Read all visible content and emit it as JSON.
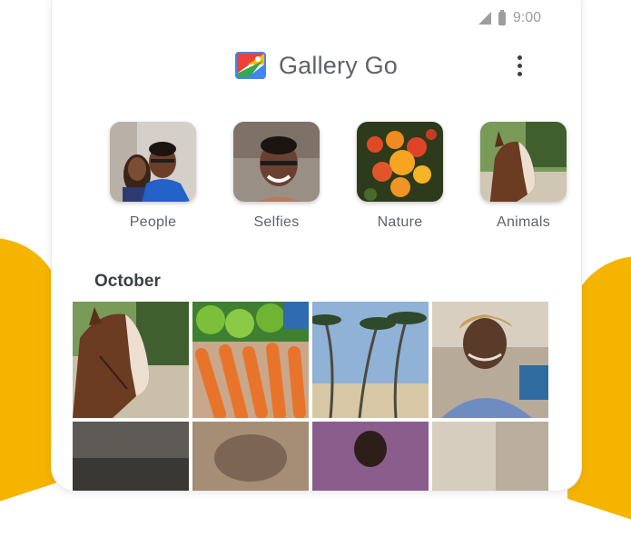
{
  "status_bar": {
    "time": "9:00",
    "icons": [
      "signal-icon",
      "battery-icon"
    ]
  },
  "header": {
    "title": "Gallery Go",
    "logo_icon": "gallery-go-logo",
    "menu_icon": "more-vert-icon",
    "logo_colors": [
      "#ea4335",
      "#fbbc04",
      "#34a853",
      "#4285f4"
    ]
  },
  "categories": [
    {
      "label": "People",
      "thumbnail": "two-people-photo"
    },
    {
      "label": "Selfies",
      "thumbnail": "selfie-photo"
    },
    {
      "label": "Nature",
      "thumbnail": "flowers-photo"
    },
    {
      "label": "Animals",
      "thumbnail": "horse-photo"
    }
  ],
  "section": {
    "title": "October"
  },
  "grid": [
    {
      "thumbnail": "horse-photo"
    },
    {
      "thumbnail": "vegetables-photo"
    },
    {
      "thumbnail": "palm-trees-photo"
    },
    {
      "thumbnail": "portrait-photo"
    },
    {
      "thumbnail": "dark-photo"
    },
    {
      "thumbnail": "blurred-photo"
    },
    {
      "thumbnail": "people-photo"
    },
    {
      "thumbnail": "light-photo"
    }
  ],
  "colors": {
    "background_accent": "#f5b400",
    "title_text": "#5f6368",
    "section_text": "#3c4043"
  }
}
